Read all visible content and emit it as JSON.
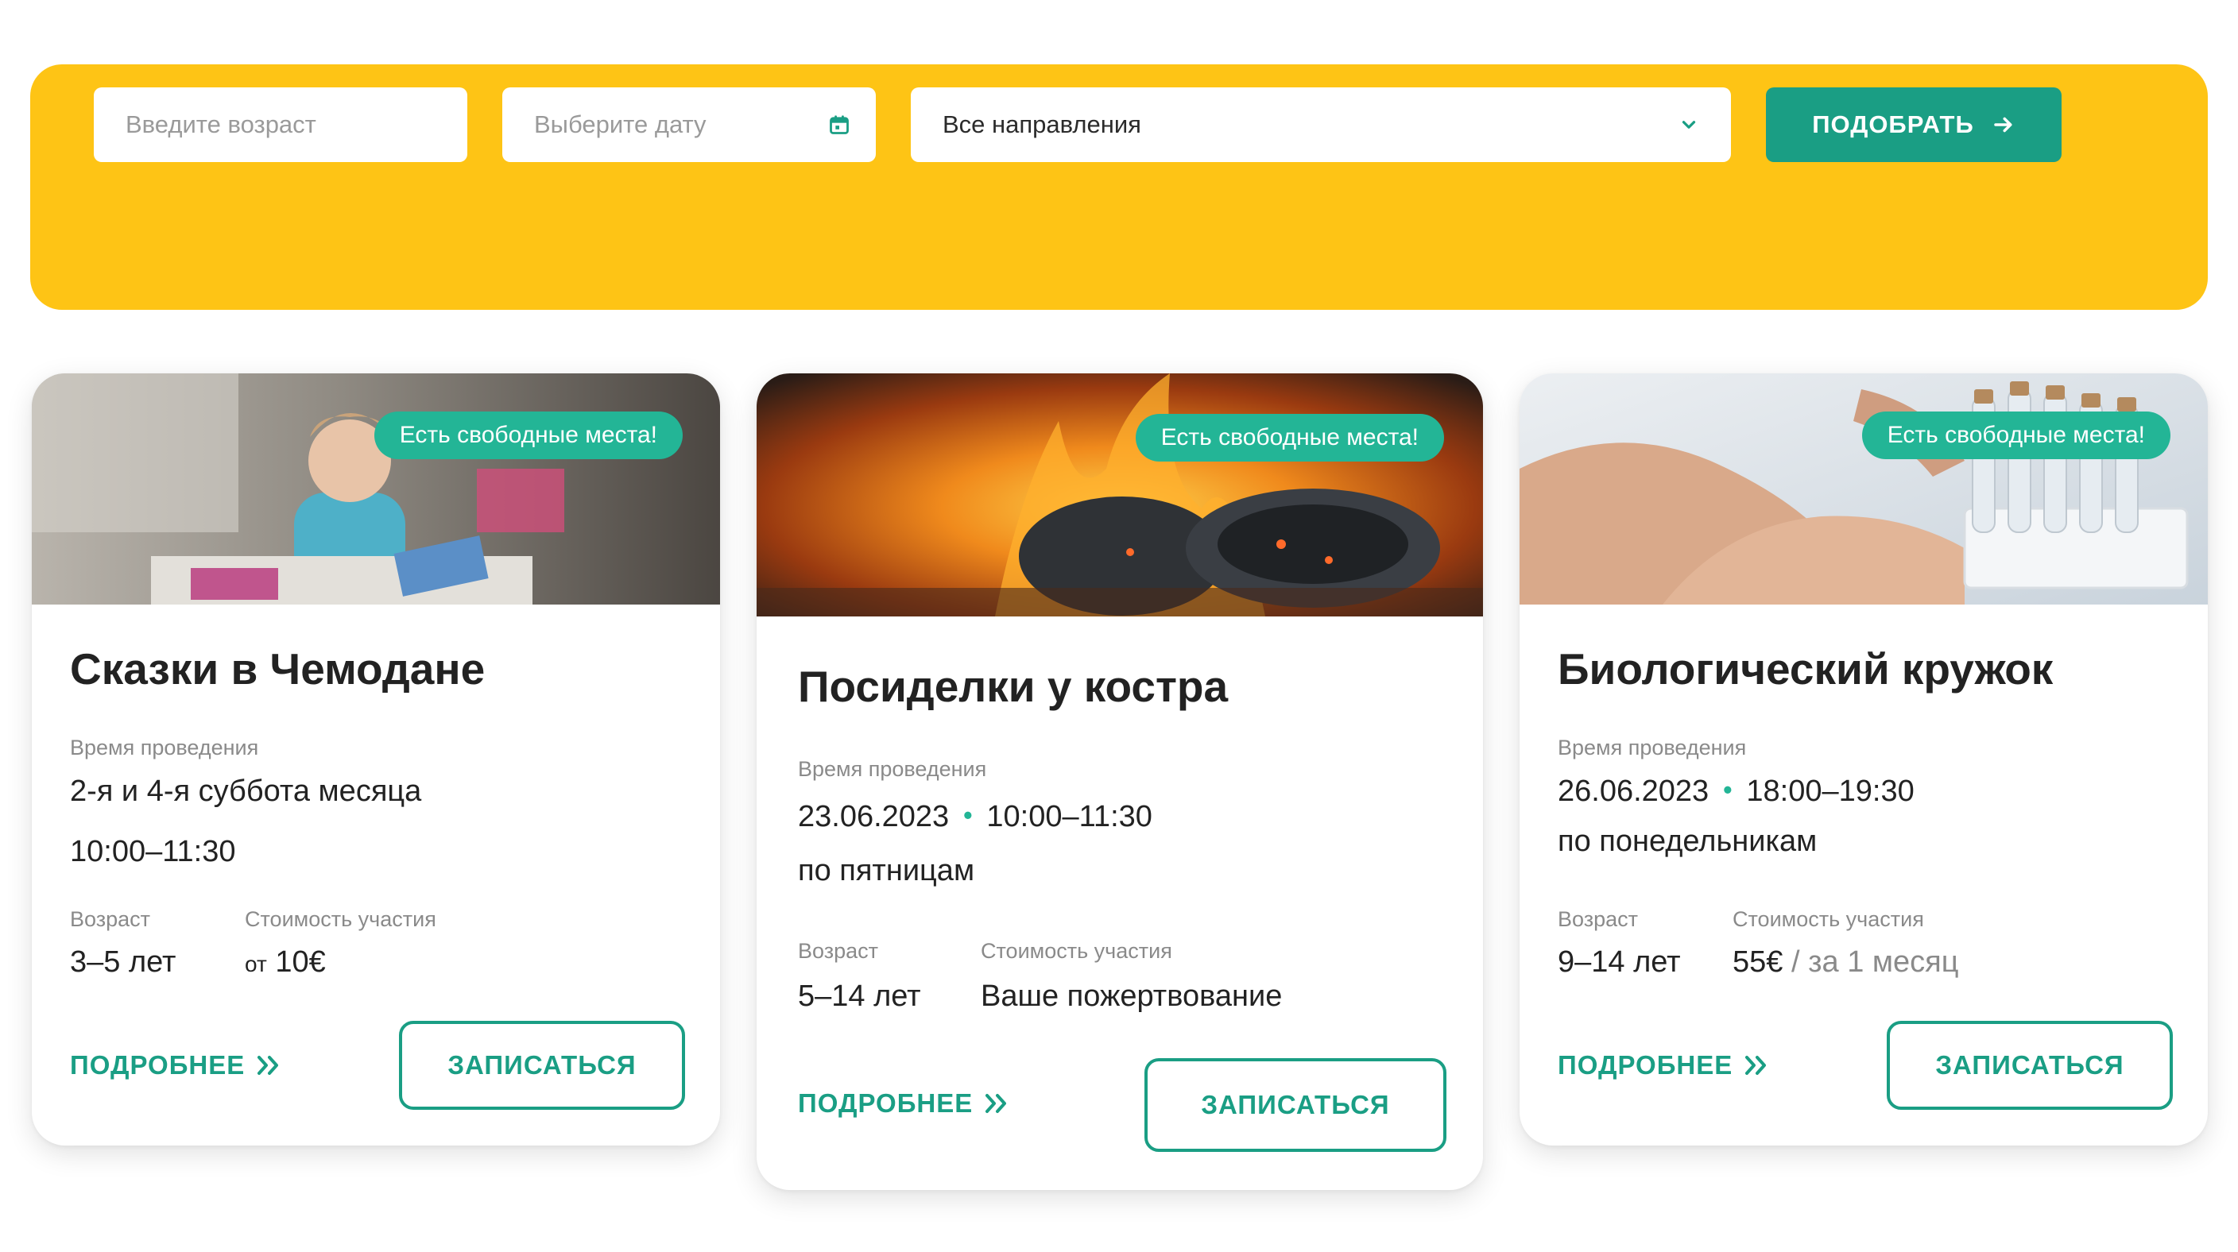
{
  "filter": {
    "age_placeholder": "Введите возраст",
    "date_placeholder": "Выберите дату",
    "direction_value": "Все направления",
    "submit_label": "ПОДОБРАТЬ",
    "icons": [
      "calendar-icon",
      "chevron-down-icon",
      "arrow-right-icon"
    ]
  },
  "colors": {
    "accent": "#1A9E84",
    "badge": "#23B596",
    "filter_bg": "#FEC415"
  },
  "cards": [
    {
      "badge": "Есть свободные места!",
      "title": "Сказки в Чемодане",
      "time_label": "Время проведения",
      "time_line1": "2-я и 4-я суббота месяца",
      "time_line2": "10:00–11:30",
      "age_label": "Возраст",
      "age_value": "3–5 лет",
      "price_label": "Стоимость участия",
      "price_prefix": "от",
      "price_value": "10€",
      "more_label": "ПОДРОБНЕЕ",
      "enroll_label": "ЗАПИСАТЬСЯ"
    },
    {
      "badge": "Есть свободные места!",
      "title": "Посиделки у костра",
      "time_label": "Время проведения",
      "date": "23.06.2023",
      "time": "10:00–11:30",
      "schedule": "по пятницам",
      "age_label": "Возраст",
      "age_value": "5–14 лет",
      "price_label": "Стоимость участия",
      "price_value": "Ваше пожертвование",
      "more_label": "ПОДРОБНЕЕ",
      "enroll_label": "ЗАПИСАТЬСЯ"
    },
    {
      "badge": "Есть свободные места!",
      "title": "Биологический кружок",
      "time_label": "Время проведения",
      "date": "26.06.2023",
      "time": "18:00–19:30",
      "schedule": "по понедельникам",
      "age_label": "Возраст",
      "age_value": "9–14 лет",
      "price_label": "Стоимость участия",
      "price_value": "55€",
      "price_suffix": "/ за 1 месяц",
      "more_label": "ПОДРОБНЕЕ",
      "enroll_label": "ЗАПИСАТЬСЯ"
    }
  ]
}
